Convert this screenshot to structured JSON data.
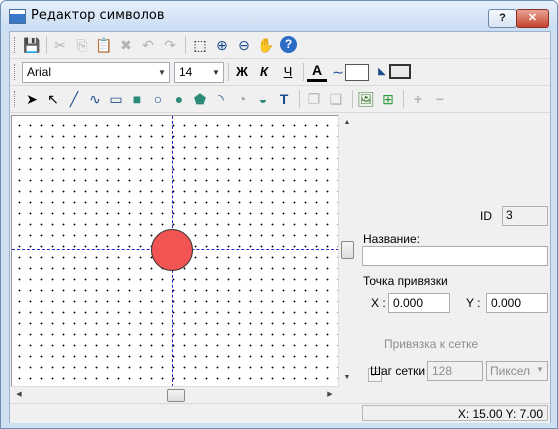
{
  "window": {
    "title": "Редактор символов",
    "help_label": "?",
    "close_label": "✕"
  },
  "toolbar1": {
    "items": [
      {
        "name": "save-icon",
        "glyph": "💾",
        "enabled": false
      },
      {
        "name": "cut-icon",
        "glyph": "✂",
        "enabled": false
      },
      {
        "name": "copy-icon",
        "glyph": "⎘",
        "enabled": false
      },
      {
        "name": "paste-icon",
        "glyph": "📋",
        "enabled": false
      },
      {
        "name": "delete-icon",
        "glyph": "✖",
        "enabled": false
      },
      {
        "name": "undo-icon",
        "glyph": "↶",
        "enabled": false
      },
      {
        "name": "redo-icon",
        "glyph": "↷",
        "enabled": false
      },
      {
        "name": "select-area-icon",
        "glyph": "⬚",
        "enabled": true
      },
      {
        "name": "zoom-in-icon",
        "glyph": "⊕",
        "enabled": true
      },
      {
        "name": "zoom-out-icon",
        "glyph": "⊖",
        "enabled": true
      },
      {
        "name": "pan-hand-icon",
        "glyph": "✋",
        "enabled": true
      },
      {
        "name": "help-icon",
        "glyph": "?",
        "enabled": true
      }
    ]
  },
  "toolbar2": {
    "font_family": "Arial",
    "font_size": "14",
    "bold_label": "Ж",
    "italic_label": "К",
    "underline_label": "Ч",
    "text_color_label": "A"
  },
  "toolbar3": {
    "items": [
      {
        "name": "pointer-tool-icon",
        "glyph": "➤"
      },
      {
        "name": "node-edit-tool-icon",
        "glyph": "↖"
      },
      {
        "name": "line-tool-icon",
        "glyph": "╱"
      },
      {
        "name": "polyline-tool-icon",
        "glyph": "∿"
      },
      {
        "name": "rectangle-tool-icon",
        "glyph": "▭"
      },
      {
        "name": "filled-rectangle-tool-icon",
        "glyph": "■"
      },
      {
        "name": "ellipse-tool-icon",
        "glyph": "○"
      },
      {
        "name": "filled-ellipse-tool-icon",
        "glyph": "●"
      },
      {
        "name": "polygon-tool-icon",
        "glyph": "⬟"
      },
      {
        "name": "arc-tool-icon",
        "glyph": "◝"
      },
      {
        "name": "pie-tool-icon",
        "glyph": "◔"
      },
      {
        "name": "chord-tool-icon",
        "glyph": "◒"
      },
      {
        "name": "text-tool-icon",
        "glyph": "T"
      },
      {
        "name": "group-icon",
        "glyph": "❐"
      },
      {
        "name": "ungroup-icon",
        "glyph": "❏"
      },
      {
        "name": "insert-image-icon",
        "glyph": "🖼"
      },
      {
        "name": "add-image-icon",
        "glyph": "⊞"
      },
      {
        "name": "add-point-icon",
        "glyph": "+"
      },
      {
        "name": "remove-point-icon",
        "glyph": "−"
      }
    ]
  },
  "properties": {
    "id_label": "ID",
    "id_value": "3",
    "name_label": "Название:",
    "name_value": "",
    "anchor_label": "Точка привязки",
    "x_label": "X :",
    "x_value": "0.000",
    "y_label": "Y :",
    "y_value": "0.000",
    "snap_label": "Привязка к сетке",
    "grid_step_label": "Шаг сетки",
    "grid_step_value": "128",
    "unit_value": "Пиксел"
  },
  "status": {
    "coords": "X: 15.00  Y: 7.00"
  },
  "colors": {
    "shape_fill": "#f25454",
    "guide_lines": "#2222cc"
  }
}
